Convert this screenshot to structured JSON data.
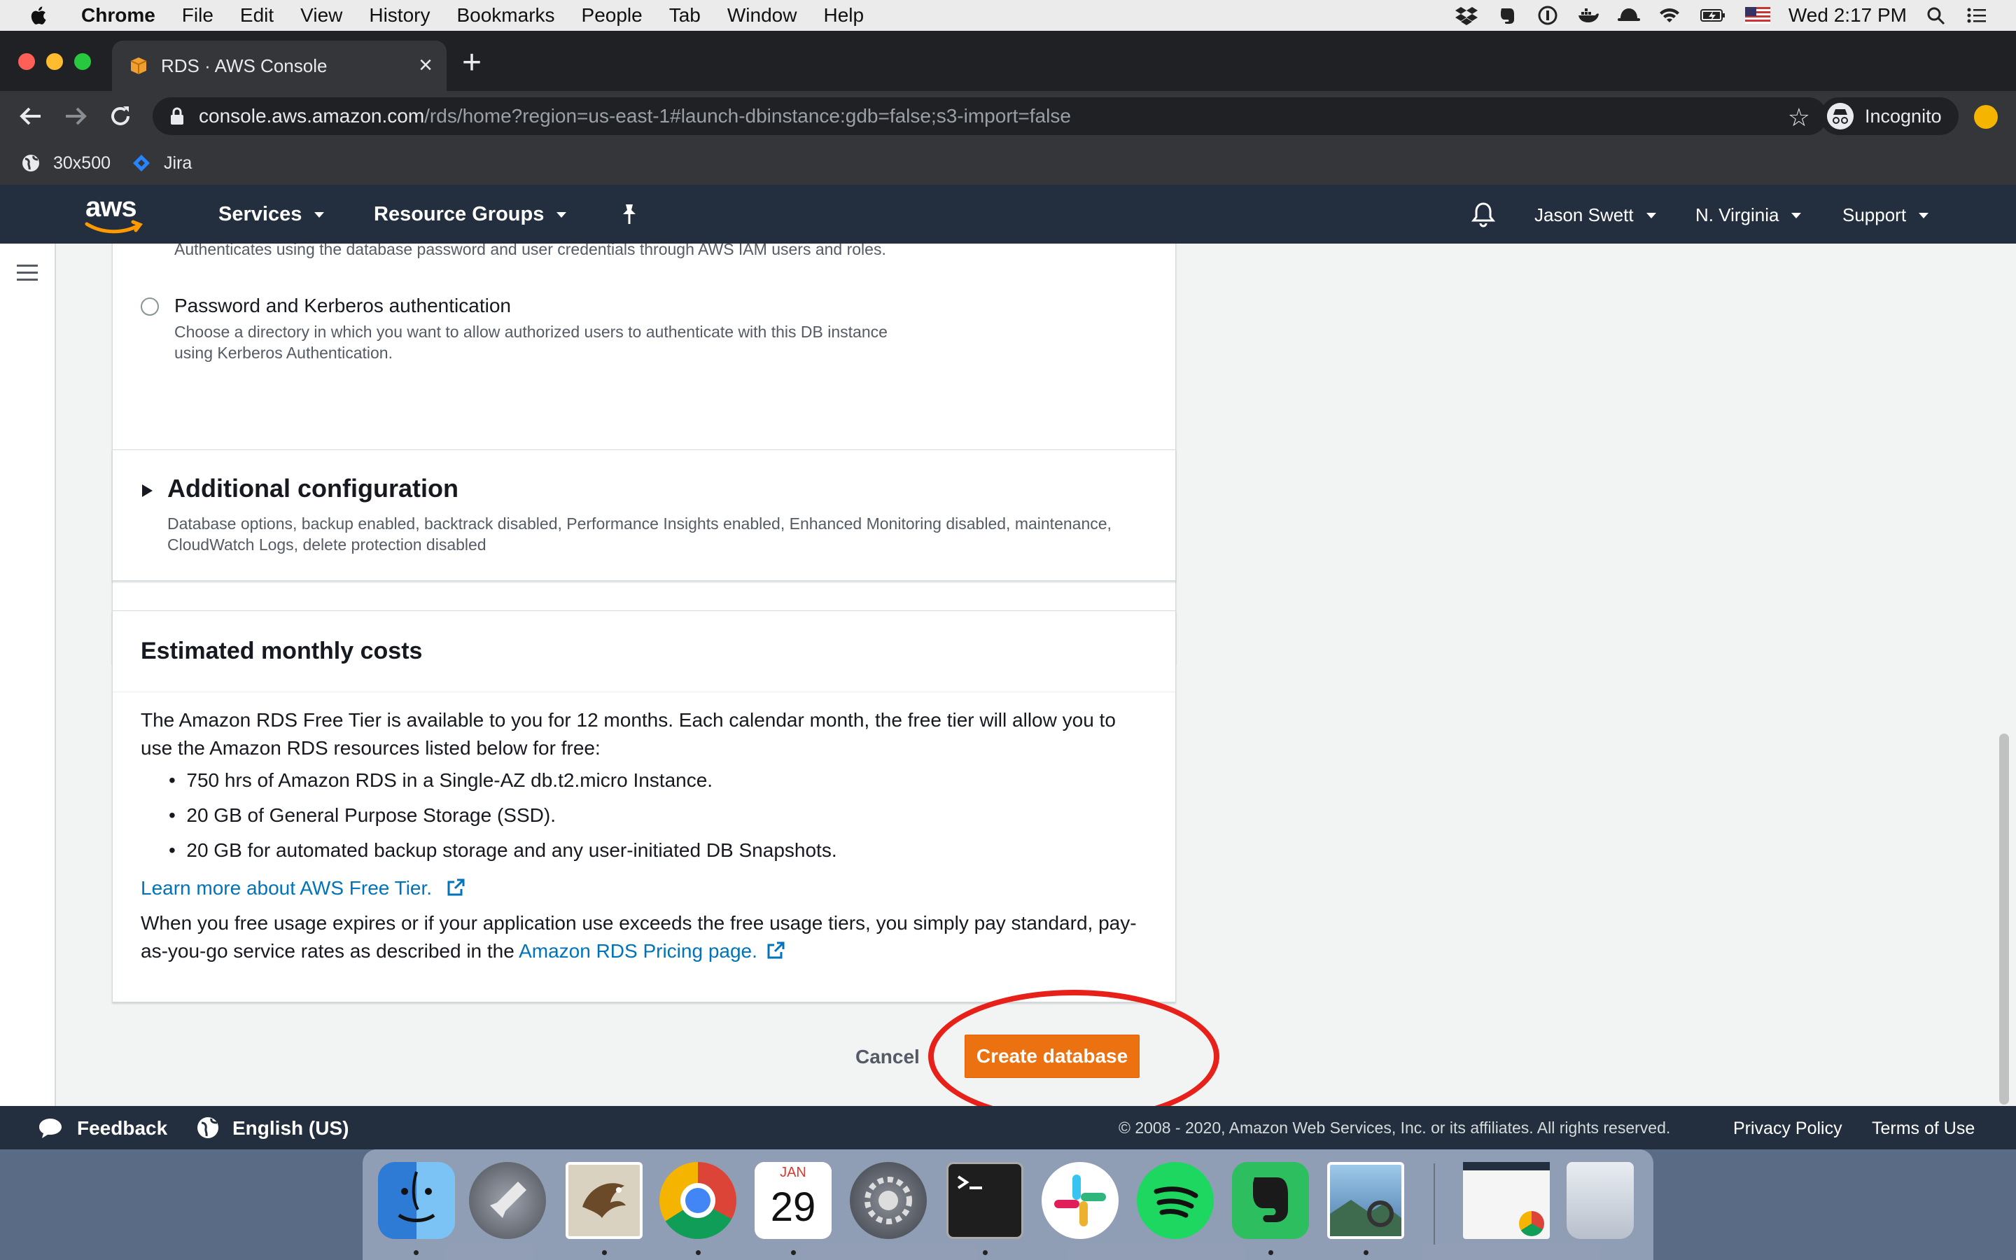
{
  "menubar": {
    "app": "Chrome",
    "items": [
      "File",
      "Edit",
      "View",
      "History",
      "Bookmarks",
      "People",
      "Tab",
      "Window",
      "Help"
    ],
    "clock": "Wed 2:17 PM"
  },
  "browser": {
    "tab_title": "RDS · AWS Console",
    "url_host": "console.aws.amazon.com",
    "url_path": "/rds/home?region=us-east-1#launch-dbinstance:gdb=false;s3-import=false",
    "profile": "Incognito",
    "bookmarks": [
      "30x500",
      "Jira"
    ]
  },
  "awsnav": {
    "logo": "aws",
    "services": "Services",
    "resource_groups": "Resource Groups",
    "user": "Jason Swett",
    "region": "N. Virginia",
    "support": "Support"
  },
  "auth": {
    "prev_desc": "Authenticates using the database password and user credentials through AWS IAM users and roles.",
    "kerberos_label": "Password and Kerberos authentication",
    "kerberos_desc": "Choose a directory in which you want to allow authorized users to authenticate with this DB instance using Kerberos Authentication."
  },
  "additional": {
    "title": "Additional configuration",
    "desc": "Database options, backup enabled, backtrack disabled, Performance Insights enabled, Enhanced Monitoring disabled, maintenance, CloudWatch Logs, delete protection disabled"
  },
  "costs": {
    "title": "Estimated monthly costs",
    "intro": "The Amazon RDS Free Tier is available to you for 12 months. Each calendar month, the free tier will allow you to use the Amazon RDS resources listed below for free:",
    "bullets": [
      "750 hrs of Amazon RDS in a Single-AZ db.t2.micro Instance.",
      "20 GB of General Purpose Storage (SSD).",
      "20 GB for automated backup storage and any user-initiated DB Snapshots."
    ],
    "learn_more": "Learn more about AWS Free Tier.",
    "outro": "When you free usage expires or if your application use exceeds the free usage tiers, you simply pay standard, pay-as-you-go service rates as described in the",
    "pricing_link": "Amazon RDS Pricing page."
  },
  "actions": {
    "cancel": "Cancel",
    "create": "Create database"
  },
  "footer": {
    "feedback": "Feedback",
    "language": "English (US)",
    "copyright": "© 2008 - 2020, Amazon Web Services, Inc. or its affiliates. All rights reserved.",
    "privacy": "Privacy Policy",
    "terms": "Terms of Use"
  },
  "dock": {
    "calendar_month": "JAN",
    "calendar_day": "29"
  },
  "colors": {
    "aws_nav": "#232f3e",
    "primary_button": "#ec7211",
    "link": "#0073bb",
    "highlight": "#e8201a"
  }
}
